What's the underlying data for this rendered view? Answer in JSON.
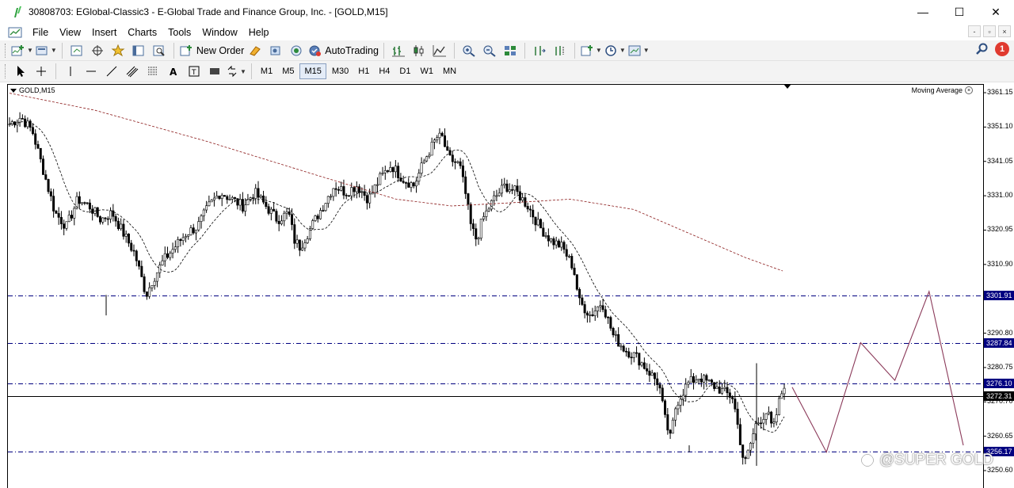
{
  "window": {
    "title": "30808703: EGlobal-Classic3 - E-Global Trade and Finance Group, Inc. - [GOLD,M15]",
    "controls": {
      "minimize": "—",
      "maximize": "☐",
      "close": "✕"
    }
  },
  "menu": {
    "items": [
      "File",
      "View",
      "Insert",
      "Charts",
      "Tools",
      "Window",
      "Help"
    ],
    "mdi": [
      "-",
      "▫",
      "×"
    ]
  },
  "toolbar": {
    "new_order_label": "New Order",
    "autotrading_label": "AutoTrading",
    "notification_count": "1"
  },
  "timeframes": {
    "items": [
      "M1",
      "M5",
      "M15",
      "M30",
      "H1",
      "H4",
      "D1",
      "W1",
      "MN"
    ],
    "active": "M15"
  },
  "chart": {
    "symbol_label": "GOLD,M15",
    "indicator_label": "Moving Average",
    "watermark": "@SUPER GOLD",
    "colors": {
      "candle": "#000000",
      "ma_fast": "#000000",
      "ma_slow": "#8b1a1a",
      "level_line": "#000080",
      "projection": "#8b3a5a"
    }
  },
  "chart_data": {
    "type": "candlestick",
    "symbol": "GOLD",
    "timeframe": "M15",
    "ylim": [
      3247,
      3363
    ],
    "y_ticks": [
      "3361.15",
      "3351.10",
      "3341.05",
      "3331.00",
      "3320.95",
      "3310.90",
      "3290.80",
      "3280.75",
      "3270.70",
      "3260.65",
      "3250.60"
    ],
    "y_tick_values": [
      3361.15,
      3351.1,
      3341.05,
      3331.0,
      3320.95,
      3310.9,
      3290.8,
      3280.75,
      3270.7,
      3260.65,
      3250.6
    ],
    "horizontal_levels": [
      {
        "label": "3301.91",
        "value": 3301.91
      },
      {
        "label": "3287.84",
        "value": 3287.84
      },
      {
        "label": "3276.10",
        "value": 3276.1
      },
      {
        "label": "3256.17",
        "value": 3256.17
      }
    ],
    "current_price": {
      "label": "3272.31",
      "value": 3272.31
    },
    "close_path": [
      [
        0,
        3352
      ],
      [
        4,
        3354
      ],
      [
        8,
        3350
      ],
      [
        12,
        3338
      ],
      [
        16,
        3326
      ],
      [
        20,
        3322
      ],
      [
        24,
        3330
      ],
      [
        28,
        3328
      ],
      [
        32,
        3324
      ],
      [
        36,
        3326
      ],
      [
        40,
        3320
      ],
      [
        44,
        3314
      ],
      [
        48,
        3302
      ],
      [
        50,
        3306
      ],
      [
        54,
        3312
      ],
      [
        58,
        3316
      ],
      [
        62,
        3320
      ],
      [
        66,
        3322
      ],
      [
        70,
        3328
      ],
      [
        74,
        3332
      ],
      [
        78,
        3330
      ],
      [
        82,
        3328
      ],
      [
        86,
        3332
      ],
      [
        90,
        3328
      ],
      [
        94,
        3324
      ],
      [
        98,
        3326
      ],
      [
        100,
        3318
      ],
      [
        102,
        3316
      ],
      [
        106,
        3322
      ],
      [
        110,
        3328
      ],
      [
        114,
        3334
      ],
      [
        118,
        3332
      ],
      [
        122,
        3334
      ],
      [
        126,
        3330
      ],
      [
        130,
        3336
      ],
      [
        134,
        3340
      ],
      [
        138,
        3336
      ],
      [
        142,
        3334
      ],
      [
        146,
        3342
      ],
      [
        150,
        3348
      ],
      [
        152,
        3348
      ],
      [
        154,
        3342
      ],
      [
        158,
        3340
      ],
      [
        160,
        3332
      ],
      [
        162,
        3322
      ],
      [
        164,
        3318
      ],
      [
        166,
        3324
      ],
      [
        170,
        3330
      ],
      [
        174,
        3334
      ],
      [
        178,
        3332
      ],
      [
        182,
        3328
      ],
      [
        186,
        3322
      ],
      [
        190,
        3318
      ],
      [
        194,
        3316
      ],
      [
        198,
        3310
      ],
      [
        200,
        3300
      ],
      [
        204,
        3296
      ],
      [
        208,
        3300
      ],
      [
        212,
        3290
      ],
      [
        216,
        3286
      ],
      [
        220,
        3284
      ],
      [
        224,
        3280
      ],
      [
        228,
        3276
      ],
      [
        230,
        3266
      ],
      [
        232,
        3260
      ],
      [
        234,
        3270
      ],
      [
        238,
        3276
      ],
      [
        242,
        3278
      ],
      [
        246,
        3276
      ],
      [
        250,
        3274
      ],
      [
        254,
        3272
      ],
      [
        256,
        3262
      ],
      [
        258,
        3252
      ],
      [
        262,
        3264
      ],
      [
        266,
        3268
      ],
      [
        268,
        3262
      ],
      [
        270,
        3270
      ],
      [
        272,
        3276
      ]
    ],
    "projection": [
      [
        3275,
        0
      ],
      [
        3256,
        1
      ],
      [
        3288,
        2
      ],
      [
        3277,
        3
      ],
      [
        3303,
        4
      ],
      [
        3258,
        5
      ]
    ],
    "series": [
      {
        "name": "Moving Average"
      }
    ]
  }
}
